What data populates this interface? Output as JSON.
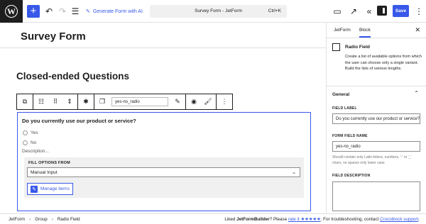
{
  "topbar": {
    "ai_label": "Generate Form with AI",
    "doc_title": "Survey Form - JetForm",
    "shortcut": "Ctrl+K",
    "save_label": "Save"
  },
  "page": {
    "title": "Survey Form",
    "heading": "Closed-ended Questions"
  },
  "block_toolbar": {
    "field_name": "yes-no_radio"
  },
  "radio_block": {
    "label": "Do you currently use our product or service?",
    "options": [
      "Yes",
      "No"
    ],
    "description_placeholder": "Description...",
    "fill_options_label": "FILL OPTIONS FROM",
    "fill_options_value": "Manual Input",
    "manage_items_label": "Manage items"
  },
  "panel": {
    "tabs": [
      "JetForm",
      "Block"
    ],
    "block_title": "Radio Field",
    "block_description": "Create a list of available options from which the user can choose only a single variant. Build the lists of various lengths.",
    "section": "General",
    "field_label_heading": "FIELD LABEL",
    "field_label_value": "Do you currently use our product or service?",
    "form_field_name_heading": "FORM FIELD NAME",
    "form_field_name_value": "yes-no_radio",
    "field_help": "Should contain only Latin letters, numbers, '-' or '_' chars, no spaces only lower case",
    "field_description_heading": "FIELD DESCRIPTION"
  },
  "footer": {
    "breadcrumbs": [
      "JetForm",
      "Group",
      "Radio Field"
    ],
    "liked_prefix": "Liked ",
    "brand": "JetFormBuilder",
    "liked_mid": "? Please ",
    "rate_link": "rate it ★★★★★",
    "trouble": ". For troubleshooting, contact ",
    "support_link": "Crocoblock support",
    "end": "."
  }
}
